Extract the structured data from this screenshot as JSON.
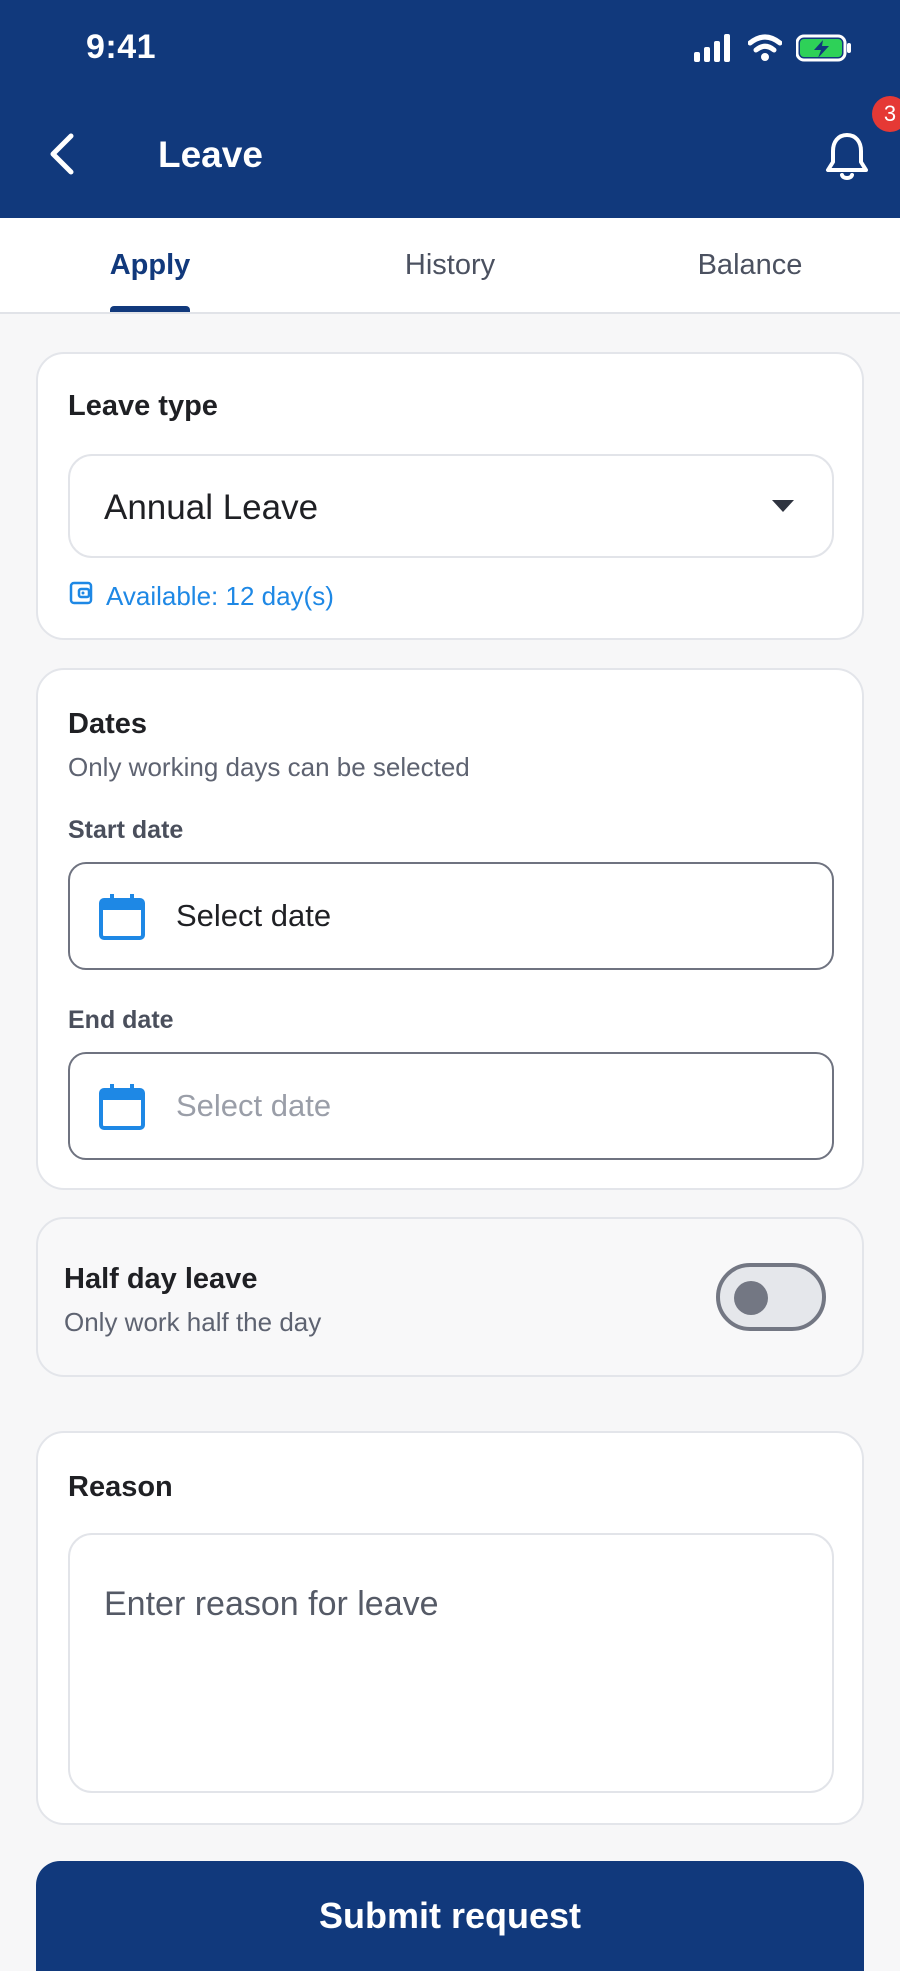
{
  "status_bar": {
    "time": "9:41",
    "icons": [
      "signal-icon",
      "wifi-icon",
      "battery-charging-icon"
    ]
  },
  "header": {
    "title": "Leave",
    "back_icon": "chevron-left-icon",
    "notification_icon": "bell-icon",
    "notification_count": "3"
  },
  "tabs": [
    {
      "label": "Apply",
      "active": true
    },
    {
      "label": "History",
      "active": false
    },
    {
      "label": "Balance",
      "active": false
    }
  ],
  "leave_type": {
    "title": "Leave type",
    "selected_value": "Annual Leave",
    "dropdown_icon": "caret-down-icon",
    "available_text": "Available: 12 day(s)",
    "available_icon": "wallet-icon"
  },
  "dates": {
    "title": "Dates",
    "subtitle": "Only working days can be selected",
    "start_label": "Start date",
    "start_value": "Select date",
    "end_label": "End date",
    "end_placeholder": "Select date",
    "calendar_icon": "calendar-icon"
  },
  "half_day": {
    "title": "Half day leave",
    "subtitle": "Only work half the day",
    "enabled": false
  },
  "reason": {
    "title": "Reason",
    "placeholder": "Enter reason for leave"
  },
  "submit": {
    "label": "Submit request"
  },
  "colors": {
    "primary": "#11397c",
    "accent": "#1e88e5",
    "badge": "#e53935",
    "background": "#f7f7f8"
  }
}
